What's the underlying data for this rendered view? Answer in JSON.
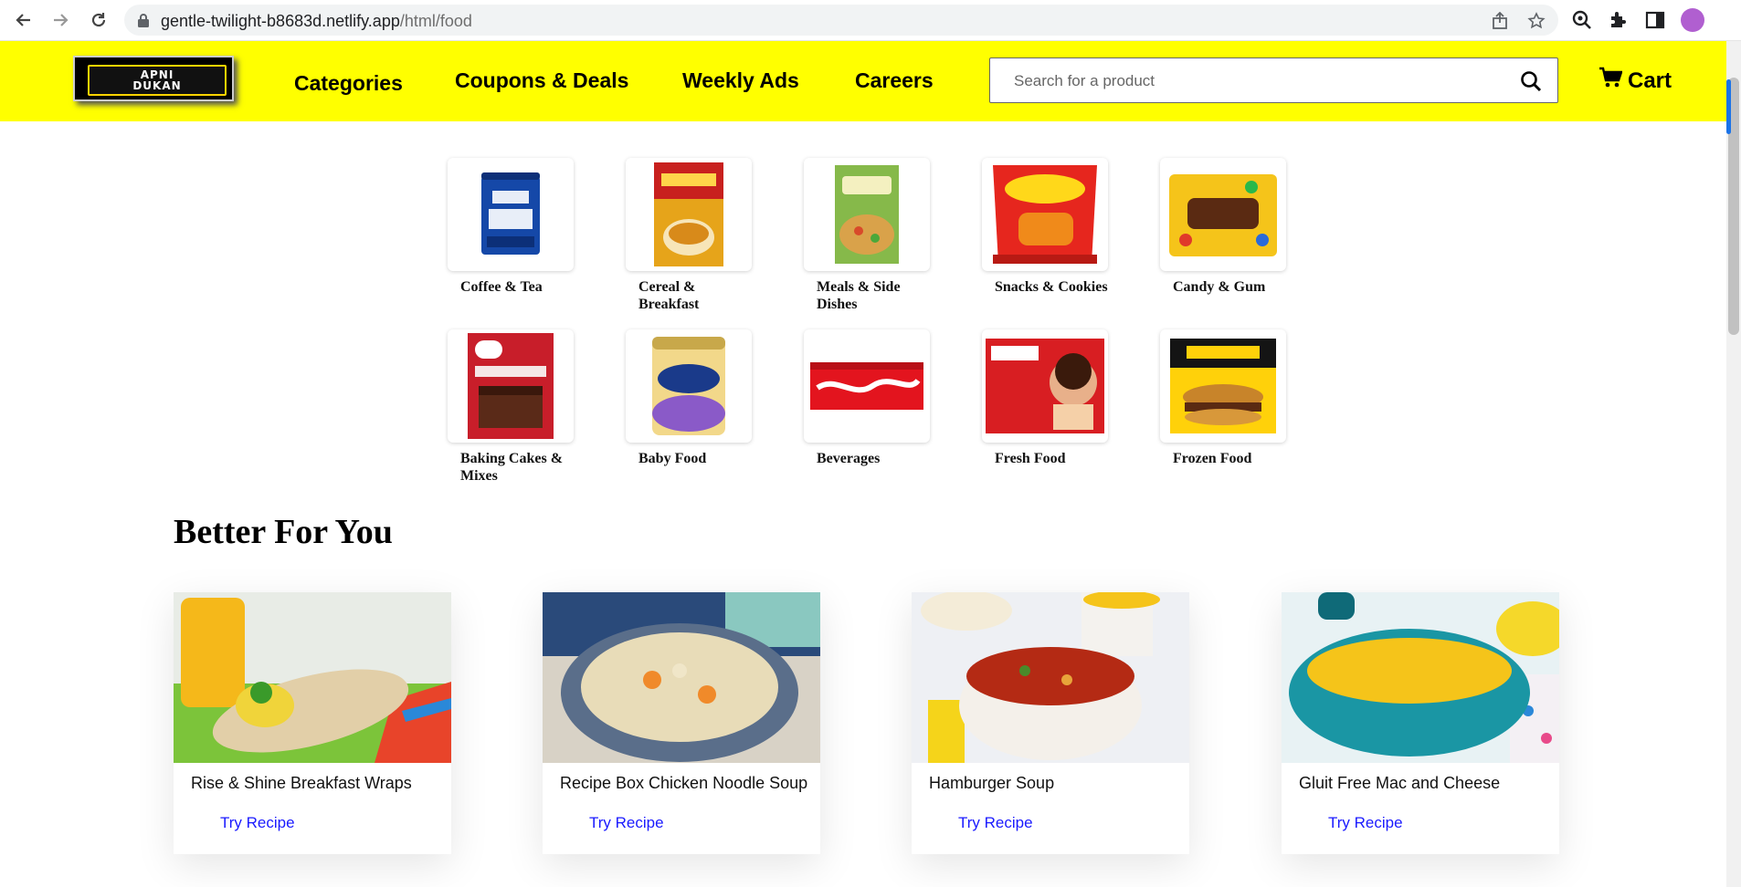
{
  "browser": {
    "url_host": "gentle-twilight-b8683d.netlify.app",
    "url_path": "/html/food"
  },
  "header": {
    "logo_line1": "APNI",
    "logo_line2": "DUKAN",
    "menu": [
      {
        "label": "Categories"
      },
      {
        "label": "Coupons & Deals"
      },
      {
        "label": "Weekly Ads"
      },
      {
        "label": "Careers"
      }
    ],
    "search": {
      "placeholder": "Search for a product"
    },
    "cart_label": "Cart",
    "accent_color": "#ffff00"
  },
  "categories": [
    {
      "label": "Coffee & Tea",
      "icon": "coffee-can"
    },
    {
      "label": "Cereal & Breakfast",
      "icon": "cereal-box"
    },
    {
      "label": "Meals & Side Dishes",
      "icon": "salad-pack"
    },
    {
      "label": "Snacks & Cookies",
      "icon": "chips-bag"
    },
    {
      "label": "Candy & Gum",
      "icon": "candy-bag"
    },
    {
      "label": "Baking Cakes & Mixes",
      "icon": "cake-mix-box"
    },
    {
      "label": "Baby Food",
      "icon": "formula-can"
    },
    {
      "label": "Beverages",
      "icon": "soda-pack"
    },
    {
      "label": "Fresh Food",
      "icon": "hotdog-pack"
    },
    {
      "label": "Frozen Food",
      "icon": "burger-box"
    }
  ],
  "better_for_you": {
    "title": "Better For You",
    "link_label": "Try Recipe",
    "recipes": [
      {
        "name": "Rise & Shine Breakfast Wraps"
      },
      {
        "name": "Recipe Box Chicken Noodle Soup"
      },
      {
        "name": "Hamburger Soup"
      },
      {
        "name": "Gluit Free Mac and Cheese"
      }
    ]
  }
}
